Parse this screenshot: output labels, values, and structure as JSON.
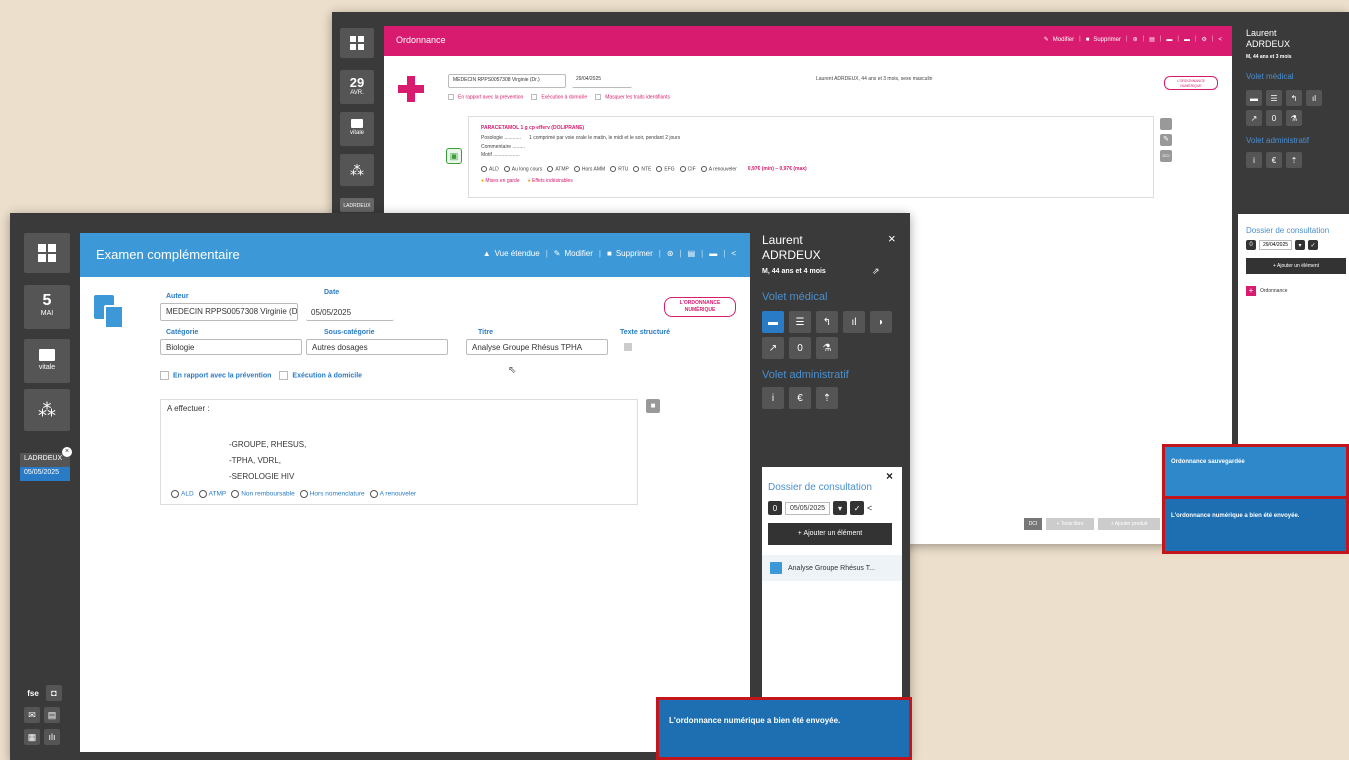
{
  "back_window": {
    "sidebar": {
      "day": "29",
      "month": "AVR.",
      "vitale_label": "vitale",
      "patient_tab_label": "LADRDEUX"
    },
    "header": {
      "title": "Ordonnance",
      "modify_label": "Modifier",
      "delete_label": "Supprimer",
      "accent": "#d81b6e"
    },
    "form": {
      "author": "MEDECIN RPPS0057308 Virginie (Dr.)",
      "date": "29/04/2025",
      "patient_info": "Laurent ADRDEUX, 44 ans et 3 mois, sexe masculin",
      "badge_line1": "L'ORDONNANCE",
      "badge_line2": "NUMÉRIQUE",
      "checkboxes": [
        "En rapport avec la prévention",
        "Exécution à domicile",
        "Masquer les traits identifiants"
      ]
    },
    "med": {
      "name": "PARACETAMOL 1 g cp efferv (DOLIPRANE)",
      "posologie_label": "Posologie ............",
      "posologie_value": "1 comprimé par voie orale le matin, le midi et le soir, pendant 2 jours",
      "commentaire_label": "Commentaire .........",
      "motif_label": "Motif ...................",
      "radios": [
        "ALD",
        "Au long cours",
        "ATMP",
        "Hors AMM",
        "RTU",
        "NTE",
        "EFG",
        "CIF",
        "A renouveler"
      ],
      "price": "0,97€ (min) – 0,97€ (max)",
      "warning1": "Mises en garde",
      "warning2": "Effets indésirables",
      "dci_label": "DCI"
    },
    "footer": {
      "dci": "DCI",
      "free_label": "Texte libre",
      "add_product": "Ajouter produit"
    },
    "right_panel": {
      "first_name": "Laurent",
      "last_name": "ADRDEUX",
      "age": "M, 44 ans et 3 mois",
      "volet_medical": "Volet médical",
      "volet_admin": "Volet administratif",
      "dossier_title": "Dossier de consultation",
      "dossier_date": "29/04/2025",
      "add_element": "Ajouter un élément",
      "item": "Ordonnance"
    },
    "toast_saved": "Ordonnance sauvegardée",
    "toast_sent": "L'ordonnance numérique a bien été envoyée."
  },
  "front_window": {
    "sidebar": {
      "day": "5",
      "month": "MAI",
      "vitale_label": "vitale",
      "patient_tab_label": "LADRDEUX",
      "patient_tab_date": "05/05/2025",
      "fse_label": "fse"
    },
    "header": {
      "title": "Examen complémentaire",
      "expand_label": "Vue étendue",
      "modify_label": "Modifier",
      "delete_label": "Supprimer",
      "accent": "#3d98d8"
    },
    "form": {
      "author_label": "Auteur",
      "author": "MEDECIN RPPS0057308 Virginie (Dr.)",
      "date_label": "Date",
      "date": "05/05/2025",
      "category_label": "Catégorie",
      "category": "Biologie",
      "subcategory_label": "Sous-catégorie",
      "subcategory": "Autres dosages",
      "title_label": "Titre",
      "title": "Analyse Groupe Rhésus TPHA",
      "structured_label": "Texte structuré",
      "prevention_label": "En rapport avec la prévention",
      "domicile_label": "Exécution à domicile",
      "badge_line1": "L'ORDONNANCE",
      "badge_line2": "NUMÉRIQUE",
      "text_heading": "A effectuer :",
      "text_lines": [
        "-GROUPE, RHESUS,",
        "-TPHA, VDRL,",
        "-SEROLOGIE HIV"
      ],
      "radios": [
        "ALD",
        "ATMP",
        "Non remboursable",
        "Hors nomenclature",
        "A renouveler"
      ]
    },
    "right_panel": {
      "first_name": "Laurent",
      "last_name": "ADRDEUX",
      "age": "M, 44 ans et 4 mois",
      "volet_medical": "Volet médical",
      "volet_admin": "Volet administratif",
      "dossier_title": "Dossier de consultation",
      "dossier_date": "05/05/2025",
      "add_element": "Ajouter un élément",
      "item": "Analyse Groupe Rhésus T..."
    },
    "toast_sent": "L'ordonnance numérique a bien été envoyée."
  }
}
